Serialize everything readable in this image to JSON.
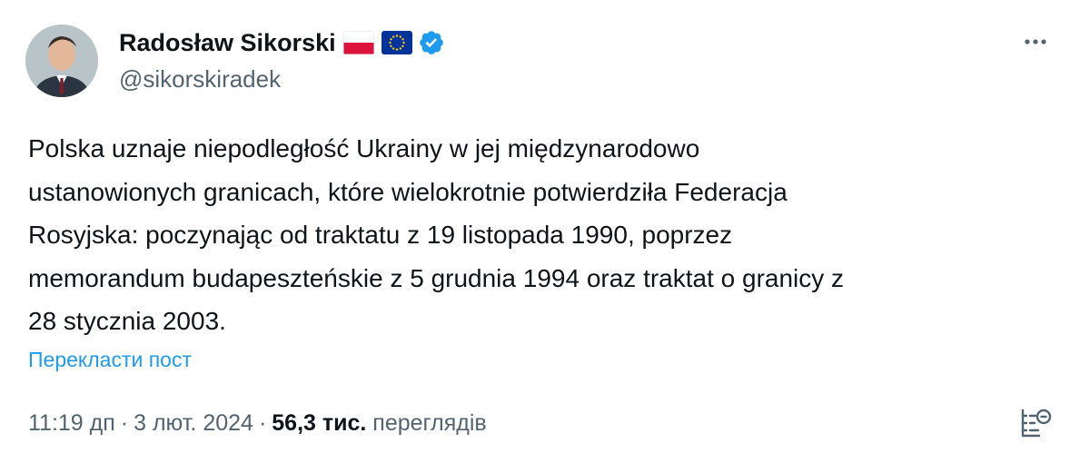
{
  "author": {
    "name": "Radosław Sikorski",
    "handle": "@sikorskiradek",
    "flags": [
      "poland-flag-icon",
      "eu-flag-icon"
    ],
    "verified_icon": "verified-badge-icon"
  },
  "tweet": {
    "lines": [
      "Polska uznaje niepodległość Ukrainy w jej międzynarodowo",
      "ustanowionych granicach, które wielokrotnie potwierdziła Federacja",
      "Rosyjska: poczynając od traktatu z 19 listopada 1990, poprzez",
      "memorandum budapeszteńskie z 5 grudnia 1994 oraz traktat o granicy z",
      "28 stycznia 2003."
    ],
    "translate_label": "Перекласти пост"
  },
  "meta": {
    "time": "11:19 дп",
    "separator": "·",
    "date": "3 лют. 2024",
    "views_count": "56,3 тис.",
    "views_label": "переглядів"
  },
  "icons": {
    "more": "more-icon",
    "analytics": "analytics-icon"
  },
  "colors": {
    "link": "#1d9bf0",
    "secondary_text": "#536471",
    "primary_text": "#0f1419",
    "verified": "#1d9bf0"
  }
}
